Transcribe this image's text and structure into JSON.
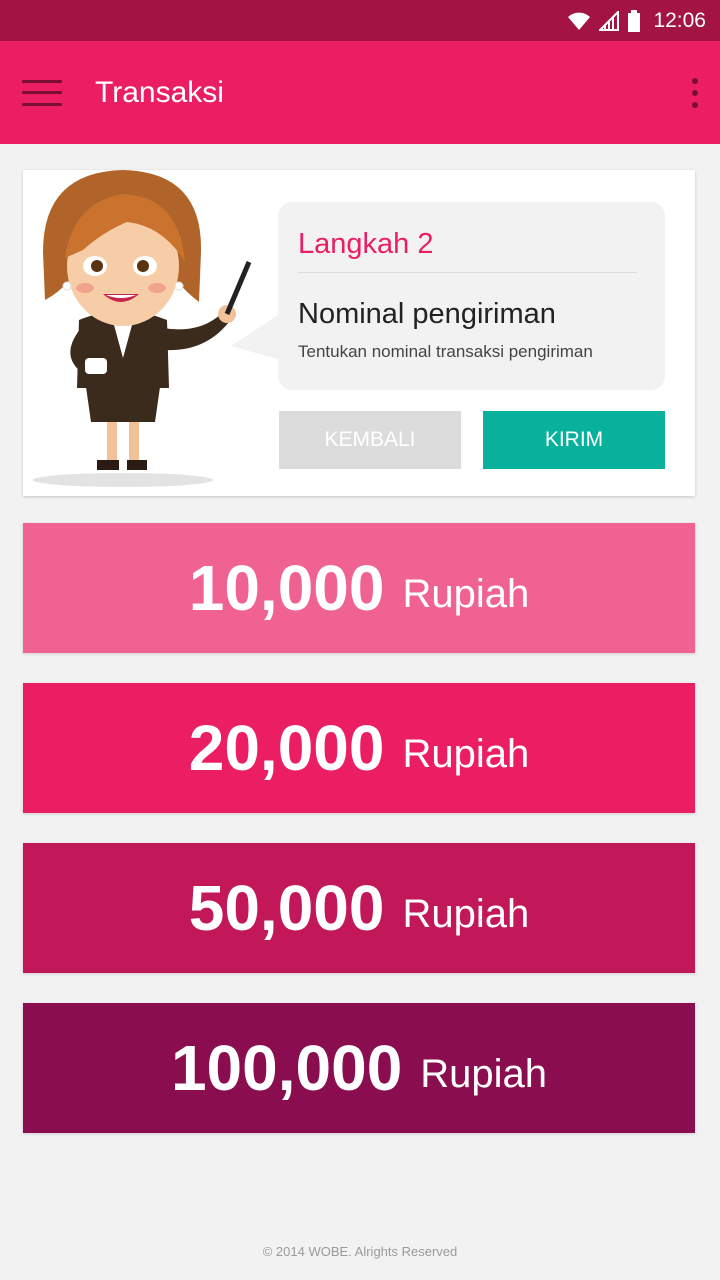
{
  "status_bar": {
    "time": "12:06"
  },
  "app_bar": {
    "title": "Transaksi"
  },
  "guide": {
    "step_title": "Langkah 2",
    "heading": "Nominal pengiriman",
    "description": "Tentukan nominal transaksi pengiriman",
    "back_label": "KEMBALI",
    "send_label": "KIRIM"
  },
  "amounts": [
    {
      "value": "10,000",
      "unit": "Rupiah",
      "color": "#f06292"
    },
    {
      "value": "20,000",
      "unit": "Rupiah",
      "color": "#ec1e63"
    },
    {
      "value": "50,000",
      "unit": "Rupiah",
      "color": "#c21759"
    },
    {
      "value": "100,000",
      "unit": "Rupiah",
      "color": "#8a0e4f"
    }
  ],
  "footer": {
    "text": "© 2014 WOBE. Alrights Reserved"
  },
  "colors": {
    "status_bar": "#a31344",
    "app_bar": "#ec1e63",
    "accent_button": "#07b19c",
    "disabled_button": "#dcdcdc"
  }
}
